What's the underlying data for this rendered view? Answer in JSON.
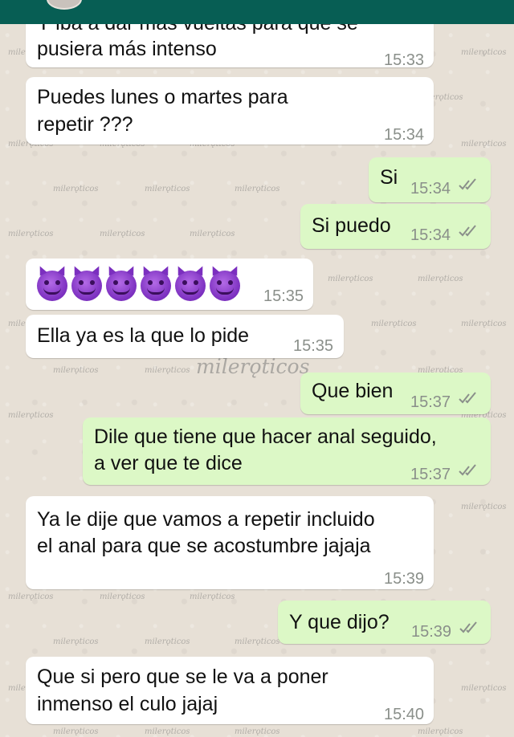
{
  "watermark": "milerǫticos",
  "colors": {
    "header": "#075e54",
    "incoming": "#ffffff",
    "outgoing": "#dcf8c6",
    "ticks": "#8a8f8a"
  },
  "messages": [
    {
      "direction": "in",
      "lines": [
        "Y iba a dar más vueltas para que se",
        "pusiera más intenso"
      ],
      "time": "15:33"
    },
    {
      "direction": "in",
      "lines": [
        "Puedes lunes o martes para",
        "repetir ???"
      ],
      "time": "15:34"
    },
    {
      "direction": "out",
      "lines": [
        "Si"
      ],
      "time": "15:34",
      "status": "double-check-icon"
    },
    {
      "direction": "out",
      "lines": [
        "Si puedo"
      ],
      "time": "15:34",
      "status": "double-check-icon"
    },
    {
      "direction": "in",
      "emoji": [
        "smiling-devil-icon",
        "smiling-devil-icon",
        "smiling-devil-icon",
        "smiling-devil-icon",
        "smiling-devil-icon",
        "smiling-devil-icon"
      ],
      "time": "15:35"
    },
    {
      "direction": "in",
      "lines": [
        "Ella ya es la que lo pide"
      ],
      "time": "15:35"
    },
    {
      "direction": "out",
      "lines": [
        "Que bien"
      ],
      "time": "15:37",
      "status": "double-check-icon"
    },
    {
      "direction": "out",
      "lines": [
        "Dile que tiene que hacer anal seguido,",
        "a ver que te dice"
      ],
      "time": "15:37",
      "status": "double-check-icon"
    },
    {
      "direction": "in",
      "lines": [
        "Ya le dije que vamos a repetir incluido",
        "el anal para que se acostumbre jajaja"
      ],
      "time": "15:39"
    },
    {
      "direction": "out",
      "lines": [
        "Y que dijo?"
      ],
      "time": "15:39",
      "status": "double-check-icon"
    },
    {
      "direction": "in",
      "lines": [
        "Que si pero que se le va a poner",
        "inmenso el culo jajaj"
      ],
      "time": "15:40"
    }
  ]
}
